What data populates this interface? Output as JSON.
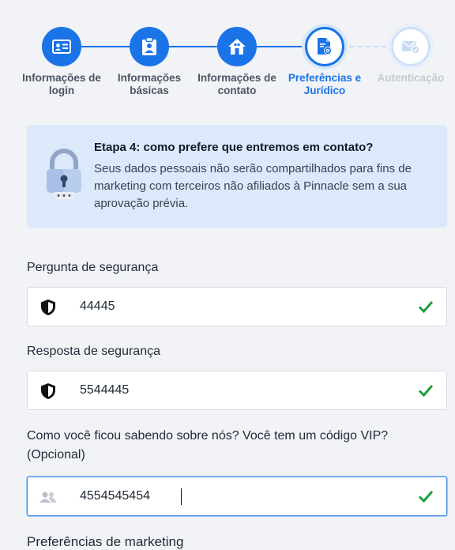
{
  "stepper": {
    "steps": [
      {
        "label": "Informações de login",
        "state": "done",
        "icon": "id-card-icon"
      },
      {
        "label": "Informações básicas",
        "state": "done",
        "icon": "clipboard-user-icon"
      },
      {
        "label": "Informações de contato",
        "state": "done",
        "icon": "house-icon"
      },
      {
        "label": "Preferências e Jurídico",
        "state": "current",
        "icon": "document-settings-icon"
      },
      {
        "label": "Autenticação",
        "state": "todo",
        "icon": "envelope-check-icon"
      }
    ]
  },
  "info": {
    "title": "Etapa 4: como prefere que entremos em contato?",
    "text": "Seus dados pessoais não serão compartilhados para fins de marketing com terceiros não afiliados à Pinnacle sem a sua aprovação prévia.",
    "icon": "padlock-icon"
  },
  "form": {
    "security_question": {
      "label": "Pergunta de segurança",
      "value": "44445",
      "icon": "shield-icon",
      "valid": true
    },
    "security_answer": {
      "label": "Resposta de segurança",
      "value": "5544445",
      "icon": "shield-icon",
      "valid": true
    },
    "referral": {
      "label": "Como você ficou sabendo sobre nós? Você tem um código VIP? (Opcional)",
      "value": "4554545454",
      "icon": "users-icon",
      "valid": true,
      "focused": true
    },
    "marketing_heading": "Preferências de marketing"
  },
  "colors": {
    "accent": "#1b73e8",
    "valid": "#1e9e3e",
    "info_bg": "#dce9fb"
  }
}
